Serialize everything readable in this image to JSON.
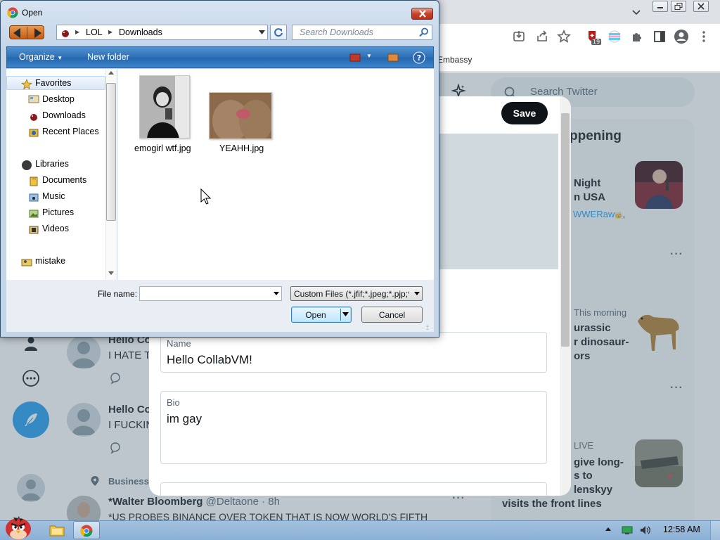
{
  "browser": {
    "bookmark_item": "Embassy",
    "extension_badge": "19"
  },
  "twitter": {
    "search_placeholder": "Search Twitter",
    "trends_title": "ppening",
    "trend_1": {
      "line1": "Night",
      "line2": "n USA",
      "link": "WWERaw",
      "emoji": "👑",
      "comma": ","
    },
    "trend_2": {
      "meta": "This morning",
      "line1": "urassic",
      "line2": "r dinosaur-",
      "line3": "ors"
    },
    "trend_3": {
      "meta": "LIVE",
      "line1": "give long-",
      "line2": "s to",
      "line3": "lenskyy",
      "line4": "visits the front lines"
    },
    "tweets": [
      {
        "name": "Hello Co",
        "body": "I HATE T"
      },
      {
        "name": "Hello Co",
        "body": "I FUCKIN"
      }
    ],
    "business_label": "Business",
    "walter": {
      "name": "*Walter Bloomberg",
      "handle": "@Deltaone · 8h",
      "body": "*US PROBES BINANCE OVER TOKEN THAT IS NOW WORLD'S FIFTH"
    }
  },
  "modal": {
    "save_label": "Save",
    "name_label": "Name",
    "name_value": "Hello CollabVM!",
    "bio_label": "Bio",
    "bio_value": "im gay"
  },
  "dialog": {
    "title": "Open",
    "breadcrumb": [
      "LOL",
      "Downloads"
    ],
    "breadcrumb_sep": "▸",
    "search_placeholder": "Search Downloads",
    "organize_label": "Organize",
    "new_folder_label": "New folder",
    "nav": {
      "favorites": "Favorites",
      "desktop": "Desktop",
      "downloads": "Downloads",
      "recent_places": "Recent Places",
      "libraries": "Libraries",
      "documents": "Documents",
      "music": "Music",
      "pictures": "Pictures",
      "videos": "Videos",
      "mistake": "mistake"
    },
    "files": [
      {
        "name": "emogirl wtf.jpg"
      },
      {
        "name": "YEAHH.jpg"
      }
    ],
    "file_name_label": "File name:",
    "file_name_value": "",
    "filter_value": "Custom Files (*.jfif;*.jpeg;*.pjp;*.jpg;*.pjpeg;*.png)",
    "open_label": "Open",
    "cancel_label": "Cancel"
  },
  "taskbar": {
    "clock": "12:58 AM"
  }
}
